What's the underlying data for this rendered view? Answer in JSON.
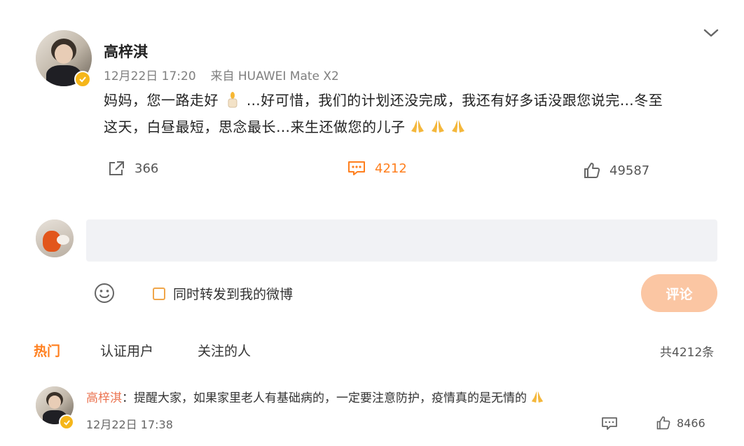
{
  "post": {
    "author": "高梓淇",
    "time": "12月22日 17:20",
    "source": "来自 HUAWEI Mate X2",
    "text_line1_a": "妈妈，您一路走好",
    "text_line1_b": "…好可惜，我们的计划还没完成，我还有好多话没跟您说完…冬至",
    "text_line2": "这天，白昼最短，思念最长…来生还做您的儿子",
    "emojis": [
      "candle-emoji",
      "pray-emoji",
      "pray-emoji",
      "pray-emoji"
    ],
    "repost_count": "366",
    "comment_count": "4212",
    "like_count": "49587"
  },
  "compose": {
    "placeholder": "",
    "repost_label": "同时转发到我的微博",
    "submit_label": "评论"
  },
  "tabs": [
    {
      "label": "热门",
      "active": true
    },
    {
      "label": "认证用户",
      "active": false
    },
    {
      "label": "关注的人",
      "active": false
    }
  ],
  "total_label": "共4212条",
  "comment": {
    "author": "高梓淇",
    "separator": "：",
    "text": "提醒大家，如果家里老人有基础病的，一定要注意防护，疫情真的是无情的",
    "time": "12月22日 17:38",
    "like_count": "8466"
  },
  "colors": {
    "accent": "#ff7f1e",
    "username_link": "#eb7350",
    "submit_disabled": "#fbc6a3",
    "verified_badge": "#f5b61a",
    "comment_bg": "#f1f2f5"
  }
}
